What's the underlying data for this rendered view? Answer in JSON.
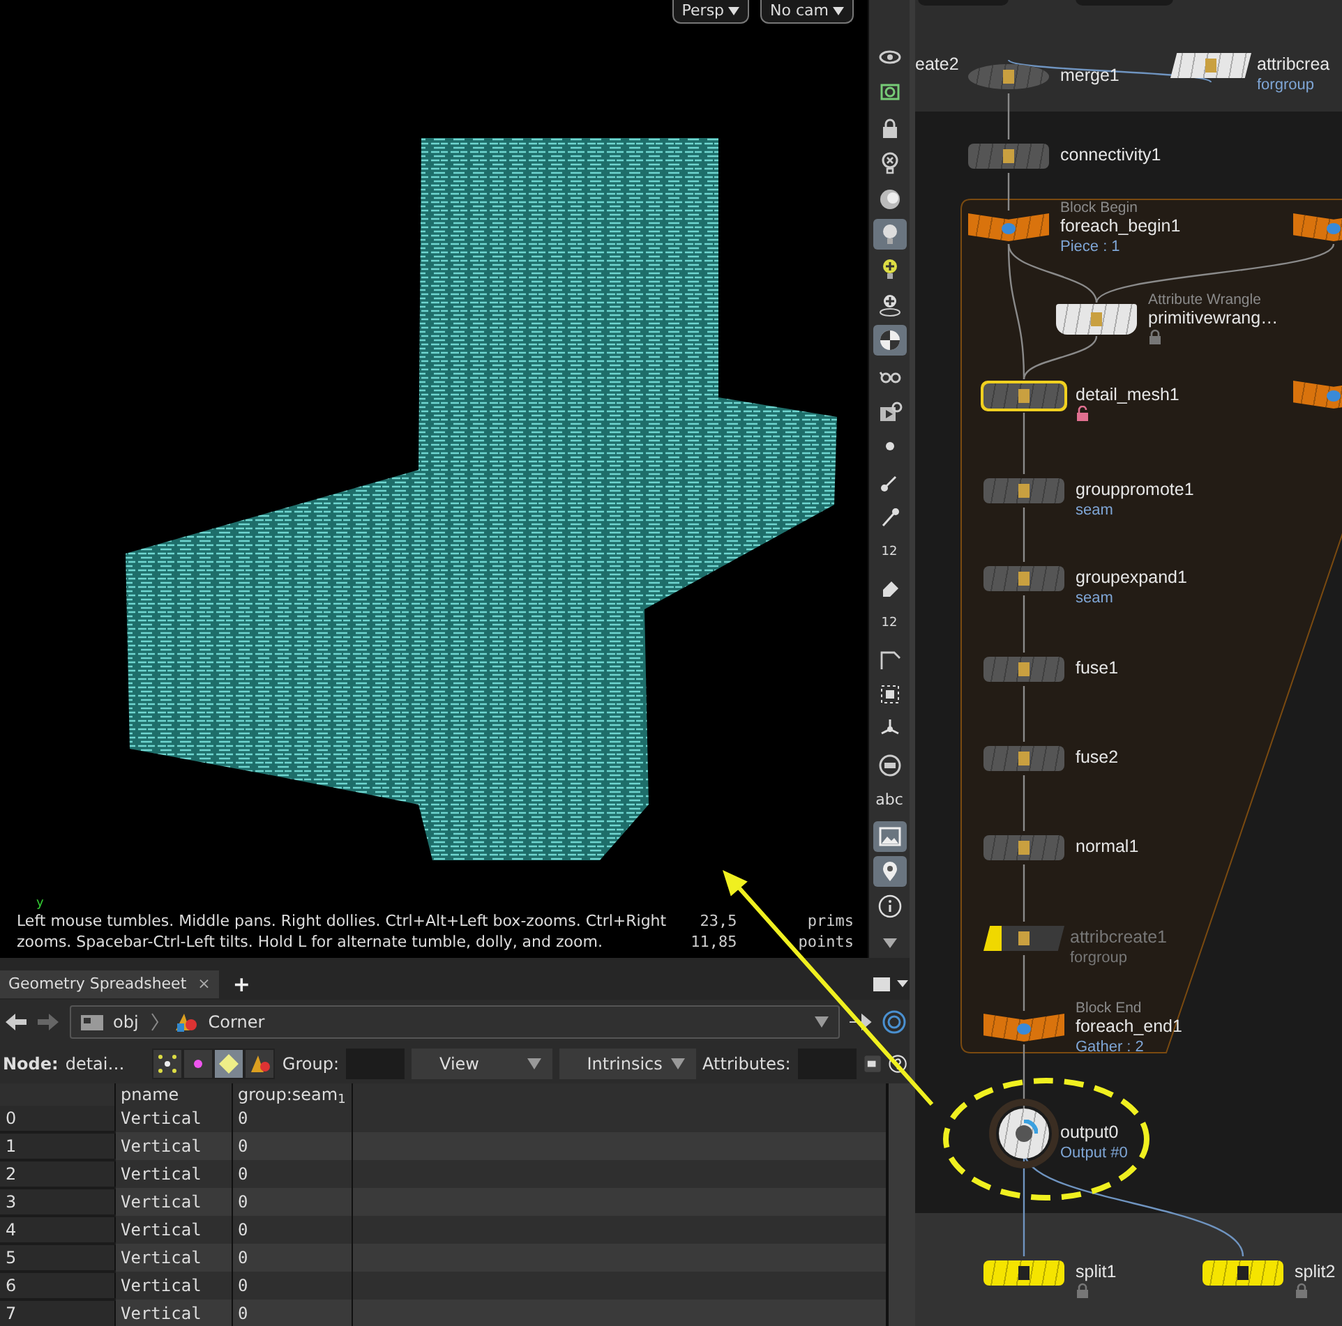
{
  "viewport": {
    "camera_buttons": [
      {
        "label": "Persp"
      },
      {
        "label": "No cam"
      }
    ],
    "axis_label": "y",
    "help_text": "Left mouse tumbles. Middle pans. Right dollies. Ctrl+Alt+Left box-zooms. Ctrl+Right zooms. Spacebar-Ctrl-Left tilts. Hold L for alternate tumble, dolly, and zoom.",
    "stats": [
      {
        "count": "23,5",
        "unit": "prims"
      },
      {
        "count": "11,85",
        "unit": "points"
      }
    ]
  },
  "viewer_tools": [
    {
      "kind": "eye",
      "on": false
    },
    {
      "kind": "shape",
      "on": false
    },
    {
      "kind": "lock",
      "on": false
    },
    {
      "kind": "bulb-x",
      "on": false
    },
    {
      "kind": "sphere",
      "on": false
    },
    {
      "kind": "bulb",
      "on": true
    },
    {
      "kind": "bulb-plus",
      "on": false
    },
    {
      "kind": "bulb-target",
      "on": false
    },
    {
      "kind": "checker",
      "on": true
    },
    {
      "kind": "glasses",
      "on": false
    },
    {
      "kind": "glasses-play",
      "on": false
    },
    {
      "kind": "dot",
      "on": false
    },
    {
      "kind": "pen",
      "on": false
    },
    {
      "kind": "pin",
      "on": false
    },
    {
      "kind": "numbers",
      "label": "12",
      "on": false
    },
    {
      "kind": "hand",
      "on": false
    },
    {
      "kind": "numbers-hand",
      "label": "12",
      "on": false
    },
    {
      "kind": "corner",
      "on": false
    },
    {
      "kind": "grid",
      "on": false
    },
    {
      "kind": "spokes",
      "on": false
    },
    {
      "kind": "circle",
      "on": false
    },
    {
      "kind": "text",
      "label": "abc",
      "on": false
    },
    {
      "kind": "image",
      "on": true
    },
    {
      "kind": "marker",
      "on": true
    },
    {
      "kind": "info",
      "on": false
    },
    {
      "kind": "down",
      "on": false
    }
  ],
  "spreadsheet": {
    "tabs": [
      {
        "label": "Geometry Spreadsheet",
        "close": "×",
        "selected": true
      }
    ],
    "add_tab": "+",
    "path": [
      {
        "kind": "obj",
        "label": "obj"
      },
      {
        "kind": "object",
        "label": "Corner"
      }
    ],
    "node_label": "Node:",
    "node_value": "detai…",
    "modes": [
      {
        "kind": "points",
        "selected": false
      },
      {
        "kind": "vertices",
        "selected": false
      },
      {
        "kind": "primitives",
        "selected": true
      },
      {
        "kind": "detail",
        "selected": false
      }
    ],
    "group_label": "Group:",
    "view_dropdown": "View",
    "intrinsics_dropdown": "Intrinsics",
    "attributes_label": "Attributes:",
    "table": {
      "columns": [
        "",
        "pname",
        "group:seam$_{1}$"
      ],
      "rows": [
        [
          "0",
          "Vertical",
          "0"
        ],
        [
          "1",
          "Vertical",
          "0"
        ],
        [
          "2",
          "Vertical",
          "0"
        ],
        [
          "3",
          "Vertical",
          "0"
        ],
        [
          "4",
          "Vertical",
          "0"
        ],
        [
          "5",
          "Vertical",
          "0"
        ],
        [
          "6",
          "Vertical",
          "0"
        ],
        [
          "7",
          "Vertical",
          "0"
        ]
      ]
    }
  },
  "network": {
    "nodes": [
      {
        "kind": "cut",
        "name": "eate2"
      },
      {
        "kind": "merge",
        "name": "merge1",
        "color": "#555555",
        "selected": false,
        "bypassed": false
      },
      {
        "kind": "param",
        "name": "attribcrea",
        "sub": "forgroup",
        "color": "#e6e6e6",
        "selected": false,
        "bypassed": false
      },
      {
        "kind": "sop",
        "name": "connectivity1",
        "color": "#555555",
        "selected": false,
        "bypassed": false
      },
      {
        "kind": "begin",
        "type": "Block Begin",
        "name": "foreach_begin1",
        "sub": "Piece : 1",
        "color": "#d9730d",
        "selected": false,
        "bypassed": false
      },
      {
        "kind": "begin",
        "color": "#d9730d",
        "selected": false,
        "bypassed": false
      },
      {
        "kind": "wrangle",
        "type": "Attribute Wrangle",
        "name": "primitivewrang…",
        "color": "#e6e6e6",
        "selected": false,
        "bypassed": false,
        "locked": true
      },
      {
        "kind": "sop",
        "name": "detail_mesh1",
        "color": "#555555",
        "selected": true,
        "bypassed": false,
        "locked": false
      },
      {
        "kind": "begin",
        "color": "#d9730d",
        "selected": false,
        "bypassed": false
      },
      {
        "kind": "sop",
        "name": "grouppromote1",
        "sub": "seam",
        "color": "#555555",
        "selected": false,
        "bypassed": false
      },
      {
        "kind": "sop",
        "name": "groupexpand1",
        "sub": "seam",
        "color": "#555555",
        "selected": false,
        "bypassed": false
      },
      {
        "kind": "sop",
        "name": "fuse1",
        "color": "#555555",
        "selected": false,
        "bypassed": false
      },
      {
        "kind": "sop",
        "name": "fuse2",
        "color": "#555555",
        "selected": false,
        "bypassed": false
      },
      {
        "kind": "sop",
        "name": "normal1",
        "color": "#555555",
        "selected": false,
        "bypassed": false
      },
      {
        "kind": "param",
        "name": "attribcreate1",
        "sub": "forgroup",
        "color": "#3a3a3a",
        "selected": false,
        "bypassed": true
      },
      {
        "kind": "end",
        "type": "Block End",
        "name": "foreach_end1",
        "sub": "Gather : 2",
        "color": "#d9730d",
        "selected": false,
        "bypassed": false
      },
      {
        "kind": "output",
        "name": "output0",
        "sub": "Output #0",
        "color": "#e6e6e6",
        "selected": false,
        "bypassed": false
      },
      {
        "kind": "sop",
        "name": "split1",
        "color": "#f5e400",
        "selected": false,
        "bypassed": false,
        "locked": true
      },
      {
        "kind": "sop",
        "name": "split2",
        "color": "#f5e400",
        "selected": false,
        "bypassed": false,
        "locked": true
      }
    ]
  }
}
